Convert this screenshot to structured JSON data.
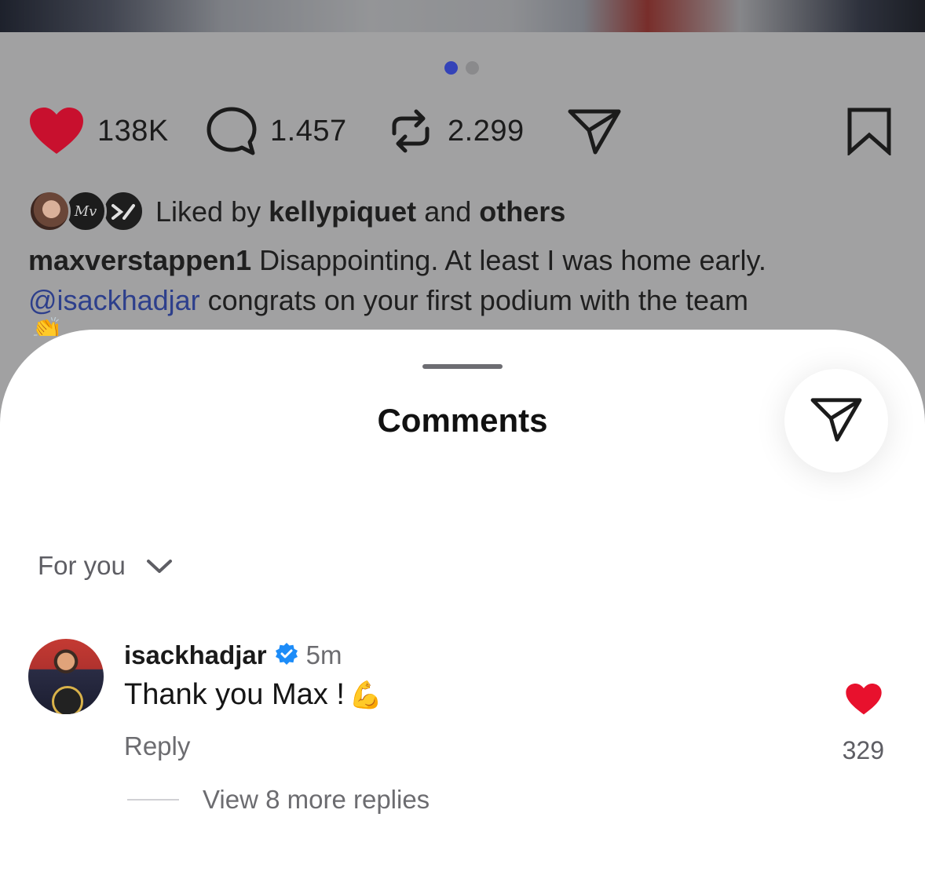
{
  "post": {
    "carousel": {
      "current": 1,
      "total": 2
    },
    "actions": {
      "likes": "138K",
      "comments": "1.457",
      "reposts": "2.299"
    },
    "liked_by": {
      "prefix": "Liked by",
      "user": "kellypiquet",
      "conjunction": "and",
      "others": "others"
    },
    "caption": {
      "user": "maxverstappen1",
      "text": "Disappointing. At least I was home early.",
      "mention": "@isackhadjar",
      "text2": "congrats on your first podium with the team",
      "emoji": "👏"
    }
  },
  "sheet": {
    "title": "Comments",
    "sort_label": "For you",
    "comment": {
      "user": "isackhadjar",
      "verified": true,
      "time": "5m",
      "text": "Thank you Max !",
      "emoji": "💪",
      "reply_label": "Reply",
      "like_count": "329",
      "view_replies": "View 8 more replies"
    }
  },
  "colors": {
    "like_red": "#c8102e",
    "comment_like_red": "#e8112d",
    "accent_blue": "#3443b8",
    "verified_blue": "#1d8cf8"
  }
}
